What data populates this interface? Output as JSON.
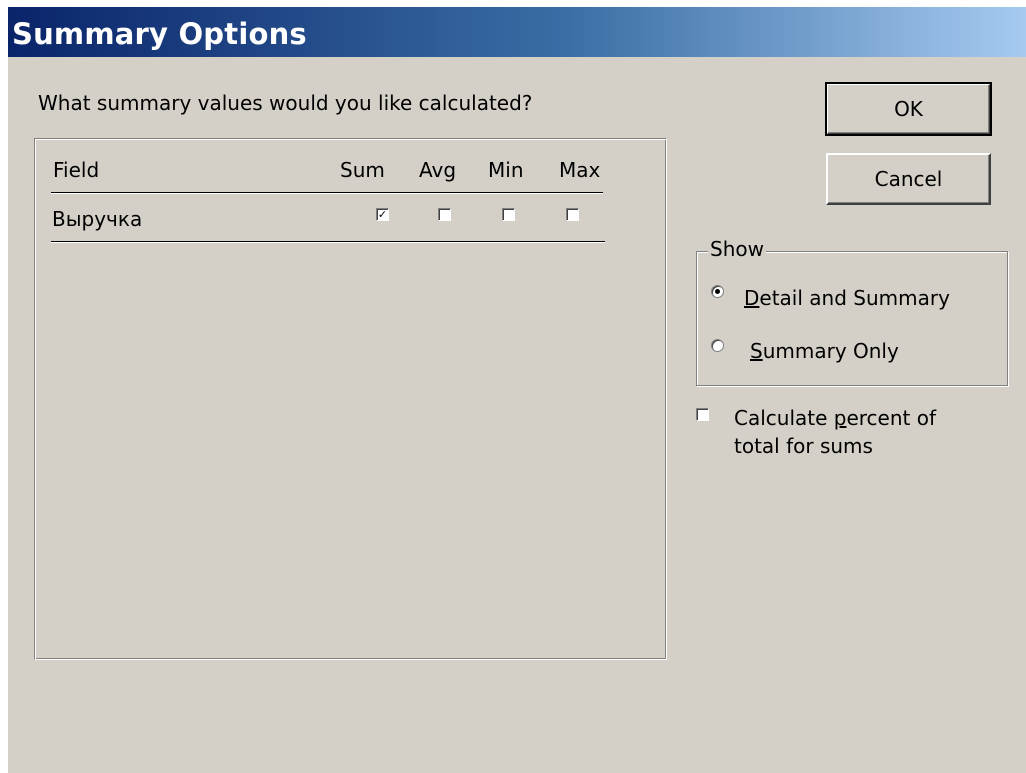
{
  "window": {
    "title": "Summary Options"
  },
  "prompt": "What summary values would you like calculated?",
  "table": {
    "headers": {
      "field": "Field",
      "sum": "Sum",
      "avg": "Avg",
      "min": "Min",
      "max": "Max"
    },
    "rows": [
      {
        "field": "Выручка",
        "sum": true,
        "avg": false,
        "min": false,
        "max": false
      }
    ]
  },
  "buttons": {
    "ok": "OK",
    "cancel": "Cancel"
  },
  "show": {
    "label": "Show",
    "options": [
      {
        "label": "Detail and Summary",
        "mnemonic": "D",
        "rest": "etail and Summary",
        "selected": true
      },
      {
        "label": "Summary Only",
        "mnemonic": "S",
        "rest": "ummary Only",
        "selected": false
      }
    ]
  },
  "percent": {
    "checked": false,
    "line1_pre": "Calculate ",
    "line1_mnemonic": "p",
    "line1_post": "ercent of",
    "line2": "total for sums"
  },
  "icons": {
    "check": "check-mark-icon"
  }
}
